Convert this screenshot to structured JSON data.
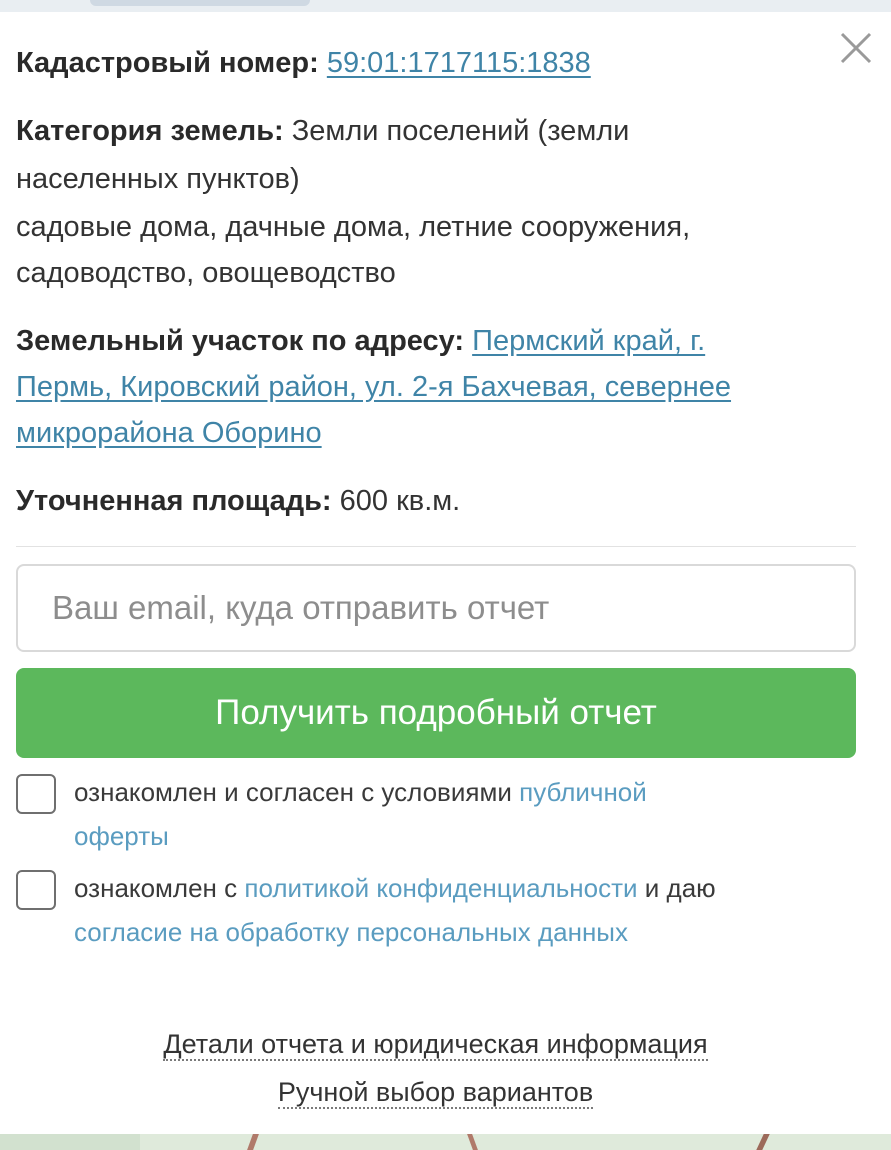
{
  "popup": {
    "cadastral": {
      "label": "Кадастровый номер:",
      "value": "59:01:1717115:1838"
    },
    "category": {
      "label": "Категория земель:",
      "line1_value": "Земли поселений (земли",
      "line2": "населенных пунктов)",
      "line3": "садовые дома, дачные дома, летние сооружения,",
      "line4": "садоводство, овощеводство"
    },
    "address": {
      "label": "Земельный участок по адресу:",
      "line1": "Пермский край, г.",
      "line2": "Пермь, Кировский район, ул. 2-я Бахчевая, севернее",
      "line3": "микрорайона Оборино"
    },
    "area": {
      "label": "Уточненная площадь:",
      "value": "600 кв.м."
    },
    "email_input": {
      "placeholder": "Ваш email, куда отправить отчет",
      "value": ""
    },
    "submit_label": "Получить подробный отчет",
    "consent1": {
      "text": "ознакомлен и согласен с условиями",
      "link_part1": "публичной",
      "link_part2": "оферты",
      "checked": false
    },
    "consent2": {
      "text_before": "ознакомлен с",
      "link1": "политикой конфиденциальности",
      "text_after": "и даю",
      "link2": "согласие на обработку персональных данных",
      "checked": false
    },
    "footer": {
      "details_link": "Детали отчета и юридическая информация",
      "manual_link": "Ручной выбор вариантов"
    }
  },
  "icons": {
    "close": "close-icon"
  },
  "colors": {
    "link": "#3f84a7",
    "button": "#5cb85c",
    "consent_link": "#5a9cc0"
  }
}
